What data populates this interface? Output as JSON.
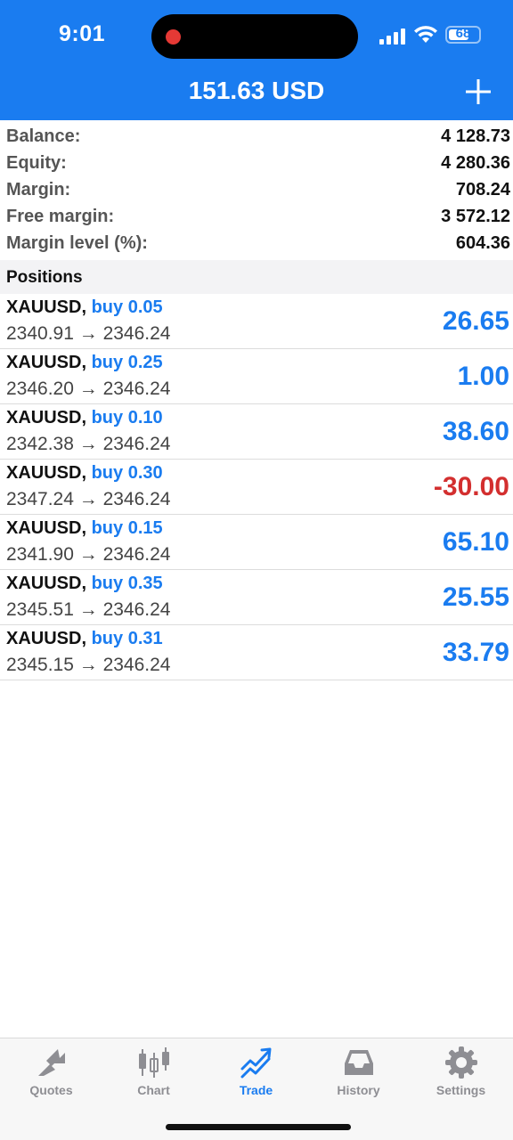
{
  "status": {
    "time": "9:01",
    "battery": "68"
  },
  "header": {
    "title": "151.63 USD"
  },
  "summary": [
    {
      "label": "Balance:",
      "value": "4 128.73"
    },
    {
      "label": "Equity:",
      "value": "4 280.36"
    },
    {
      "label": "Margin:",
      "value": "708.24"
    },
    {
      "label": "Free margin:",
      "value": "3 572.12"
    },
    {
      "label": "Margin level (%):",
      "value": "604.36"
    }
  ],
  "positions_header": "Positions",
  "positions": [
    {
      "symbol": "XAUUSD,",
      "side": "buy 0.05",
      "prices": "2340.91 → 2346.24",
      "profit": "26.65"
    },
    {
      "symbol": "XAUUSD,",
      "side": "buy 0.25",
      "prices": "2346.20 → 2346.24",
      "profit": "1.00"
    },
    {
      "symbol": "XAUUSD,",
      "side": "buy 0.10",
      "prices": "2342.38 → 2346.24",
      "profit": "38.60"
    },
    {
      "symbol": "XAUUSD,",
      "side": "buy 0.30",
      "prices": "2347.24 → 2346.24",
      "profit": "-30.00"
    },
    {
      "symbol": "XAUUSD,",
      "side": "buy 0.15",
      "prices": "2341.90 → 2346.24",
      "profit": "65.10"
    },
    {
      "symbol": "XAUUSD,",
      "side": "buy 0.35",
      "prices": "2345.51 → 2346.24",
      "profit": "25.55"
    },
    {
      "symbol": "XAUUSD,",
      "side": "buy 0.31",
      "prices": "2345.15 → 2346.24",
      "profit": "33.79"
    }
  ],
  "tabs": [
    {
      "label": "Quotes",
      "icon": "quotes-icon",
      "active": false
    },
    {
      "label": "Chart",
      "icon": "candlestick-chart-icon",
      "active": false
    },
    {
      "label": "Trade",
      "icon": "trade-icon",
      "active": true
    },
    {
      "label": "History",
      "icon": "inbox-history-icon",
      "active": false
    },
    {
      "label": "Settings",
      "icon": "gear-icon",
      "active": false
    }
  ],
  "colors": {
    "accent": "#1a7cf0",
    "negative": "#d32f2f"
  }
}
